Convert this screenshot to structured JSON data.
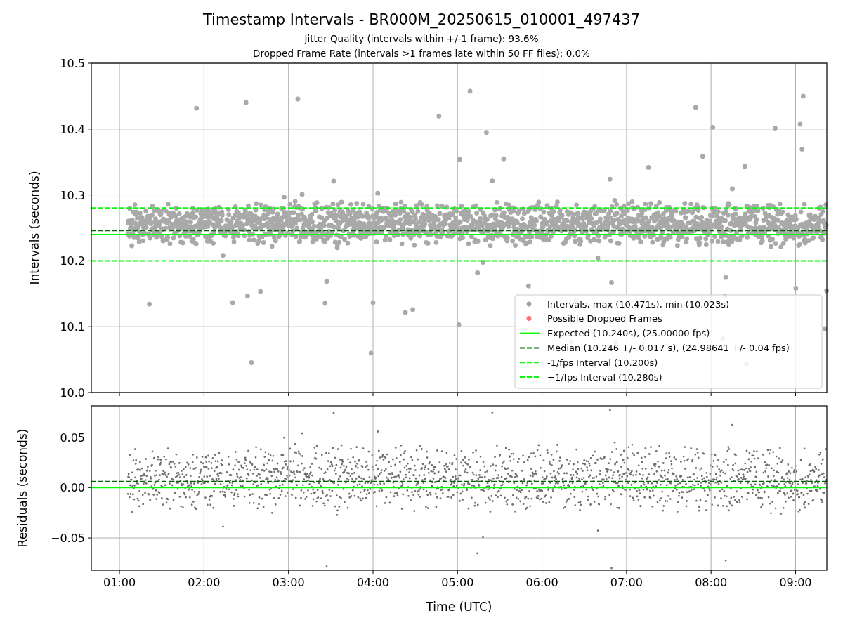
{
  "figure": {
    "title": "Timestamp Intervals - BR000M_20250615_010001_497437",
    "subtitles": [
      "Jitter Quality (intervals within +/-1 frame): 93.6%",
      "Dropped Frame Rate (intervals >1 frames late within 50 FF files): 0.0%"
    ]
  },
  "intervals_plot": {
    "legend_markers": [
      {
        "label": "Intervals, max (10.471s), min (10.023s)",
        "color": "#a0a0a0"
      },
      {
        "label": "Possible Dropped Frames",
        "color": "#ff7070"
      }
    ],
    "chart_data": {
      "type": "line",
      "ylabel": "Intervals (seconds)",
      "grid": true,
      "legend": true,
      "x": [
        0.667,
        9.37
      ],
      "xlim": [
        0.667,
        9.37
      ],
      "ylim": [
        10.0,
        10.5
      ],
      "yticks": [
        {
          "value": 10.0,
          "label": "10.0"
        },
        {
          "value": 10.1,
          "label": "10.1"
        },
        {
          "value": 10.2,
          "label": "10.2"
        },
        {
          "value": 10.3,
          "label": "10.3"
        },
        {
          "value": 10.4,
          "label": "10.4"
        },
        {
          "value": 10.5,
          "label": "10.5"
        }
      ],
      "series": [
        {
          "name": "Expected (10.240s), (25.00000 fps)",
          "color": "#00ff00",
          "line_style": "solid",
          "values": [
            10.24,
            10.24
          ]
        },
        {
          "name": "Median (10.246 +/- 0.017 s), (24.98641 +/- 0.04 fps)",
          "color": "#006400",
          "line_style": "dashed",
          "values": [
            10.246,
            10.246
          ]
        },
        {
          "name": "-1/fps Interval (10.200s)",
          "color": "#00ff00",
          "line_style": "dashed",
          "values": [
            10.2,
            10.2
          ]
        },
        {
          "name": "+1/fps Interval (10.280s)",
          "color": "#00ff00",
          "line_style": "dashed",
          "values": [
            10.28,
            10.28
          ]
        }
      ]
    }
  },
  "residuals_plot": {
    "chart_data": {
      "type": "line",
      "xlabel": "Time (UTC)",
      "ylabel": "Residuals (seconds)",
      "grid": true,
      "x": [
        0.667,
        9.37
      ],
      "xlim": [
        0.667,
        9.37
      ],
      "ylim": [
        -0.082,
        0.081
      ],
      "xticks": [
        {
          "value": 1,
          "label": "01:00"
        },
        {
          "value": 2,
          "label": "02:00"
        },
        {
          "value": 3,
          "label": "03:00"
        },
        {
          "value": 4,
          "label": "04:00"
        },
        {
          "value": 5,
          "label": "05:00"
        },
        {
          "value": 6,
          "label": "06:00"
        },
        {
          "value": 7,
          "label": "07:00"
        },
        {
          "value": 8,
          "label": "08:00"
        },
        {
          "value": 9,
          "label": "09:00"
        }
      ],
      "yticks": [
        {
          "value": -0.05,
          "label": "−0.05"
        },
        {
          "value": 0,
          "label": "0.00"
        },
        {
          "value": 0.05,
          "label": "0.05"
        }
      ],
      "series": [
        {
          "color": "#006400",
          "line_style": "dashed",
          "values": [
            0.006,
            0.006
          ]
        },
        {
          "color": "#00ff00",
          "line_style": "solid",
          "values": [
            0,
            0
          ]
        }
      ]
    }
  }
}
